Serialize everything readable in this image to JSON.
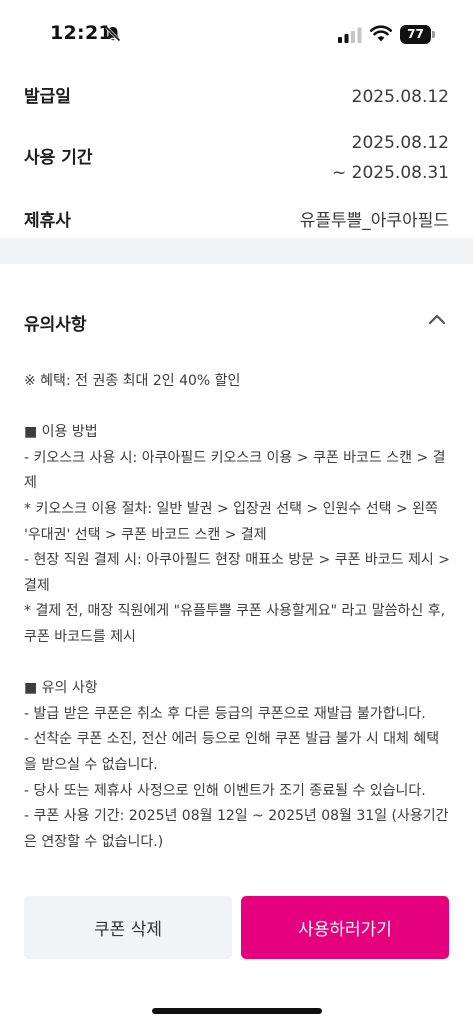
{
  "status_bar": {
    "time": "12:21",
    "battery": "77"
  },
  "info": {
    "issue_date_label": "발급일",
    "issue_date_value": "2025.08.12",
    "period_label": "사용 기간",
    "period_start": "2025.08.12",
    "period_end": "~ 2025.08.31",
    "partner_label": "제휴사",
    "partner_value": "유플투쁠_아쿠아필드"
  },
  "notice": {
    "title": "유의사항",
    "body": "※ 혜택: 전 권종 최대 2인 40% 할인\n\n■ 이용 방법\n- 키오스크 사용 시: 아쿠아필드 키오스크 이용 > 쿠폰 바코드 스캔 > 결제\n* 키오스크 이용 절차: 일반 발권 > 입장권 선택 > 인원수 선택 > 왼쪽 '우대권' 선택 > 쿠폰 바코드 스캔 > 결제\n- 현장 직원 결제 시: 아쿠아필드 현장 매표소 방문 > 쿠폰 바코드 제시 > 결제\n* 결제 전, 매장 직원에게 \"유플투쁠 쿠폰 사용할게요\" 라고 말씀하신 후, 쿠폰 바코드를 제시\n\n■ 유의 사항\n- 발급 받은 쿠폰은 취소 후 다른 등급의 쿠폰으로 재발급 불가합니다.\n- 선착순 쿠폰 소진, 전산 에러 등으로 인해 쿠폰 발급 불가 시 대체 혜택을 받으실 수 없습니다.\n- 당사 또는 제휴사 사정으로 인해 이벤트가 조기 종료될 수 있습니다.\n- 쿠폰 사용 기간: 2025년 08월 12일 ~ 2025년 08월 31일 (사용기간은 연장할 수 없습니다.)"
  },
  "buttons": {
    "delete_label": "쿠폰 삭제",
    "use_label": "사용하러가기"
  },
  "colors": {
    "accent": "#e5007e",
    "secondary_button": "#f2f3f5",
    "divider": "#f3f4f6"
  },
  "icons": {
    "bell": "bell-slash-icon",
    "signal": "cellular-signal-icon",
    "wifi": "wifi-icon",
    "battery": "battery-icon",
    "chevron": "chevron-up-icon"
  }
}
